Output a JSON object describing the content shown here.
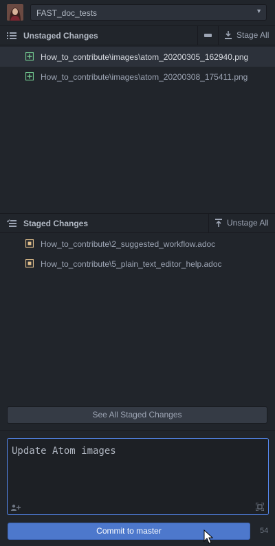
{
  "repo": {
    "name": "FAST_doc_tests"
  },
  "unstaged": {
    "title": "Unstaged Changes",
    "stage_all_label": "Stage All",
    "files": [
      {
        "name": "How_to_contribute\\images\\atom_20200305_162940.png",
        "status": "added",
        "selected": true
      },
      {
        "name": "How_to_contribute\\images\\atom_20200308_175411.png",
        "status": "added",
        "selected": false
      }
    ]
  },
  "staged": {
    "title": "Staged Changes",
    "unstage_all_label": "Unstage All",
    "files": [
      {
        "name": "How_to_contribute\\2_suggested_workflow.adoc",
        "status": "modified"
      },
      {
        "name": "How_to_contribute\\5_plain_text_editor_help.adoc",
        "status": "modified"
      }
    ]
  },
  "see_all_label": "See All Staged Changes",
  "commit": {
    "message": "Update Atom images",
    "button_label": "Commit to master",
    "remaining_chars": "54"
  },
  "colors": {
    "added": "#73c990",
    "modified": "#e2c08d",
    "accent": "#568af2"
  }
}
